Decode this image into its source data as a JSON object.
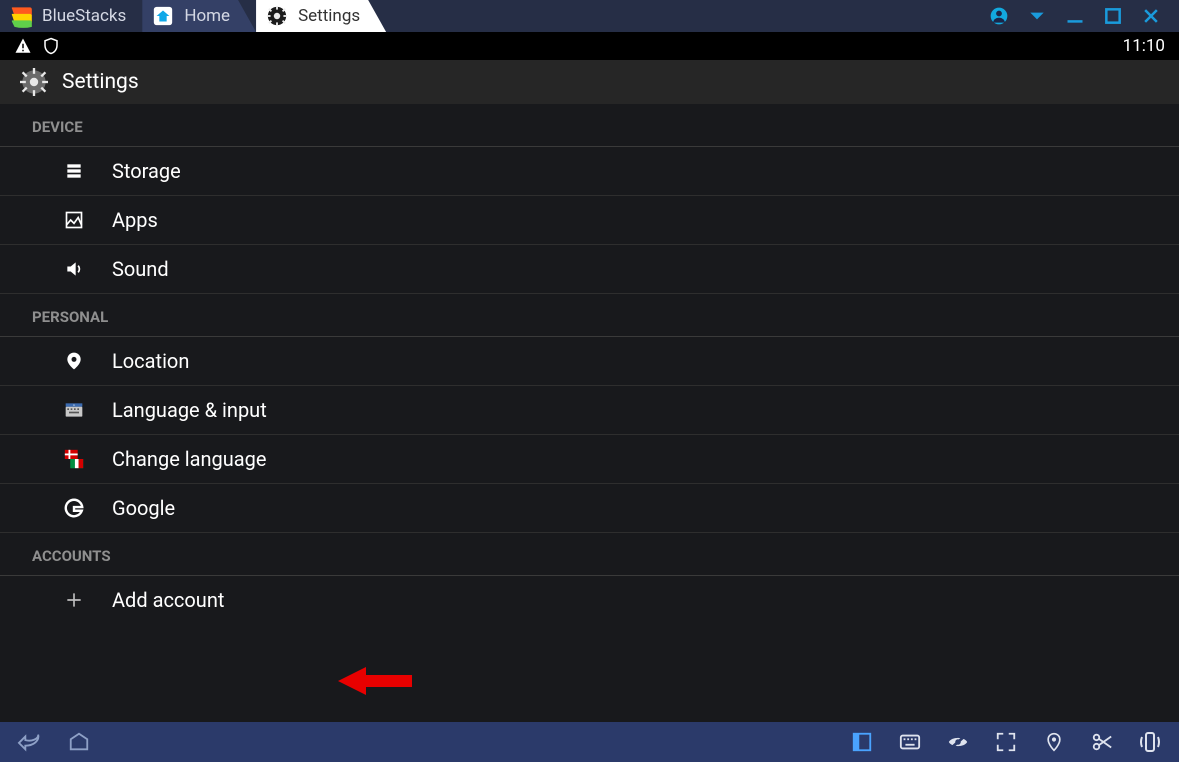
{
  "app": {
    "name": "BlueStacks"
  },
  "tabs": [
    {
      "label": "Home",
      "icon": "home-icon"
    },
    {
      "label": "Settings",
      "icon": "gear-icon"
    }
  ],
  "statusbar": {
    "time": "11:10"
  },
  "header": {
    "title": "Settings"
  },
  "sections": [
    {
      "title": "DEVICE",
      "items": [
        {
          "icon": "storage-icon",
          "label": "Storage"
        },
        {
          "icon": "apps-icon",
          "label": "Apps"
        },
        {
          "icon": "sound-icon",
          "label": "Sound"
        }
      ]
    },
    {
      "title": "PERSONAL",
      "items": [
        {
          "icon": "location-icon",
          "label": "Location"
        },
        {
          "icon": "keyboard-icon",
          "label": "Language & input"
        },
        {
          "icon": "flags-icon",
          "label": "Change language"
        },
        {
          "icon": "google-g-icon",
          "label": "Google"
        }
      ]
    },
    {
      "title": "ACCOUNTS",
      "items": [
        {
          "icon": "plus-icon",
          "label": "Add account"
        }
      ]
    }
  ]
}
